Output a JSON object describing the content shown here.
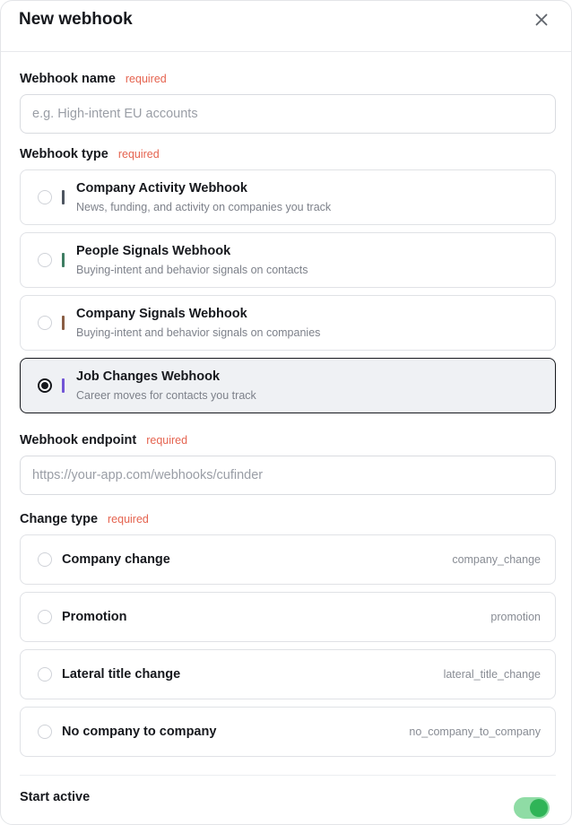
{
  "modal": {
    "title": "New webhook"
  },
  "fields": {
    "name": {
      "label": "Webhook name",
      "required": "required",
      "placeholder": "e.g. High-intent EU accounts",
      "value": ""
    },
    "type": {
      "label": "Webhook type",
      "required": "required"
    },
    "endpoint": {
      "label": "Webhook endpoint",
      "required": "required",
      "placeholder": "https://your-app.com/webhooks/cufinder",
      "value": ""
    },
    "change_type": {
      "label": "Change type",
      "required": "required"
    },
    "start_active": {
      "label": "Start active",
      "on": true
    }
  },
  "webhook_types": [
    {
      "title": "Company Activity Webhook",
      "description": "News, funding, and activity on companies you track",
      "accent": "#4d5560",
      "selected": false
    },
    {
      "title": "People Signals Webhook",
      "description": "Buying-intent and behavior signals on contacts",
      "accent": "#3e7d62",
      "selected": false
    },
    {
      "title": "Company Signals Webhook",
      "description": "Buying-intent and behavior signals on companies",
      "accent": "#8a5e44",
      "selected": false
    },
    {
      "title": "Job Changes Webhook",
      "description": "Career moves for contacts you track",
      "accent": "#7255d6",
      "selected": true
    }
  ],
  "change_types": [
    {
      "label": "Company change",
      "code": "company_change"
    },
    {
      "label": "Promotion",
      "code": "promotion"
    },
    {
      "label": "Lateral title change",
      "code": "lateral_title_change"
    },
    {
      "label": "No company to company",
      "code": "no_company_to_company"
    }
  ],
  "colors": {
    "required": "#e5634f",
    "toggle_on": "#2fb457",
    "selected_border": "#16181d"
  },
  "icons": {
    "close": "close-icon"
  }
}
